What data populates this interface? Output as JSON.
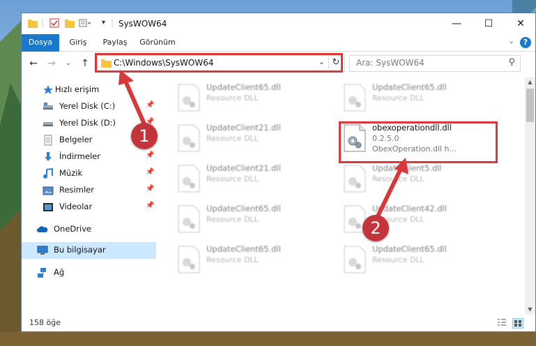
{
  "window": {
    "title": "SysWOW64",
    "controls": {
      "minimize": "—",
      "maximize": "☐",
      "close": "✕"
    }
  },
  "ribbon": {
    "tabs": [
      "Dosya",
      "Giriş",
      "Paylaş",
      "Görünüm"
    ],
    "help": "?"
  },
  "navigation": {
    "back": "←",
    "forward": "→",
    "recent": "⌄",
    "up": "↑",
    "address": "C:\\Windows\\SysWOW64",
    "search_placeholder": "Ara: SysWOW64"
  },
  "sidebar": {
    "items": [
      {
        "label": "Hızlı erişim",
        "icon": "star-icon",
        "pinned": false
      },
      {
        "label": "Yerel Disk (C:)",
        "icon": "drive-icon",
        "pinned": true
      },
      {
        "label": "Yerel Disk (D:)",
        "icon": "drive-icon",
        "pinned": true
      },
      {
        "label": "Belgeler",
        "icon": "documents-icon",
        "pinned": true
      },
      {
        "label": "İndirmeler",
        "icon": "download-icon",
        "pinned": true
      },
      {
        "label": "Müzik",
        "icon": "music-icon",
        "pinned": true
      },
      {
        "label": "Resimler",
        "icon": "pictures-icon",
        "pinned": true
      },
      {
        "label": "Videolar",
        "icon": "videos-icon",
        "pinned": true
      },
      {
        "label": "OneDrive",
        "icon": "cloud-icon",
        "pinned": false
      },
      {
        "label": "Bu bilgisayar",
        "icon": "computer-icon",
        "pinned": false,
        "selected": true
      },
      {
        "label": "Ağ",
        "icon": "network-icon",
        "pinned": false
      }
    ]
  },
  "files": [
    {
      "name": "UpdateClient65.dll",
      "desc": "Resource DLL"
    },
    {
      "name": "UpdateClient65.dll",
      "desc": "Resource DLL"
    },
    {
      "name": "UpdateClient21.dll",
      "desc": "Resource DLL"
    },
    {
      "name": "obexoperationdll.dll",
      "version": "0.2.5.0",
      "desc": "ObexOperation.dll h..."
    },
    {
      "name": "UpdateClient21.dll",
      "desc": "Resource DLL"
    },
    {
      "name": "UpdateClient5.dll",
      "desc": "Resource DLL"
    },
    {
      "name": "UpdateClient65.dll",
      "desc": "Resource DLL"
    },
    {
      "name": "UpdateClient42.dll",
      "desc": "Resource DLL"
    },
    {
      "name": "UpdateClient65.dll",
      "desc": "Resource DLL"
    },
    {
      "name": "UpdateClient65.dll",
      "desc": "Resource DLL"
    }
  ],
  "status": {
    "count": "158 öğe"
  },
  "annotations": {
    "badge1": "1",
    "badge2": "2"
  },
  "colors": {
    "accent": "#1979ca",
    "highlight": "#d9383b",
    "selected": "#cce8ff"
  }
}
